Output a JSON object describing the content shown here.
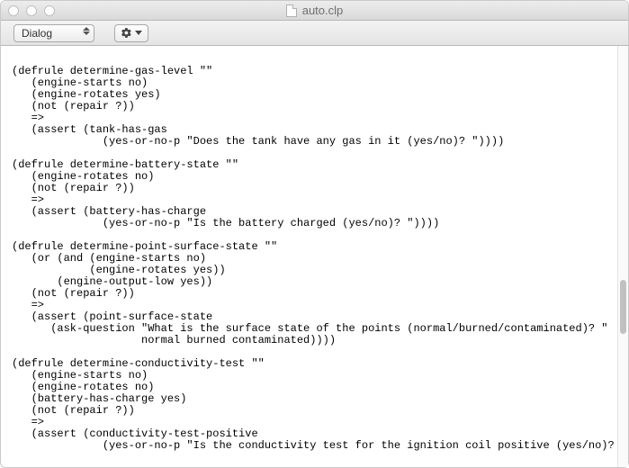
{
  "window": {
    "title": "auto.clp"
  },
  "toolbar": {
    "font_select_label": "Dialog",
    "gear_tooltip": "Settings"
  },
  "editor": {
    "content": "(defrule determine-gas-level \"\"\n   (engine-starts no)\n   (engine-rotates yes)\n   (not (repair ?))\n   =>\n   (assert (tank-has-gas\n              (yes-or-no-p \"Does the tank have any gas in it (yes/no)? \"))))\n\n(defrule determine-battery-state \"\"\n   (engine-rotates no)\n   (not (repair ?))\n   =>\n   (assert (battery-has-charge\n              (yes-or-no-p \"Is the battery charged (yes/no)? \"))))\n\n(defrule determine-point-surface-state \"\"\n   (or (and (engine-starts no)\n            (engine-rotates yes))\n       (engine-output-low yes))\n   (not (repair ?))\n   =>\n   (assert (point-surface-state\n      (ask-question \"What is the surface state of the points (normal/burned/contaminated)? \"\n                    normal burned contaminated))))\n\n(defrule determine-conductivity-test \"\"\n   (engine-starts no)\n   (engine-rotates no)\n   (battery-has-charge yes)\n   (not (repair ?))\n   =>\n   (assert (conductivity-test-positive\n              (yes-or-no-p \"Is the conductivity test for the ignition coil positive (yes/no)? \"))))"
  }
}
